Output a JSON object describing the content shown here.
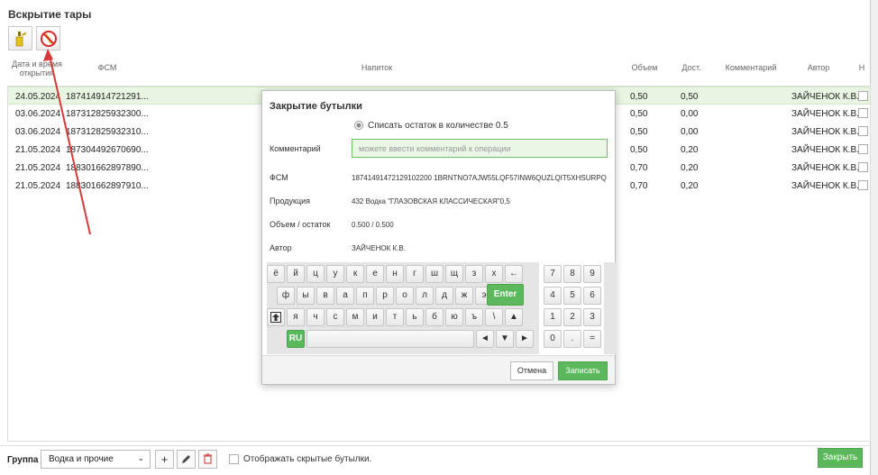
{
  "title": "Вскрытие тары",
  "toolbar": {
    "open_icon": "bottle-open-icon",
    "forbid_icon": "no-bottle-icon"
  },
  "table": {
    "headers": {
      "date": "Дата и время открытия",
      "fsm": "ФСМ",
      "drink": "Напиток",
      "volume": "Объем",
      "remain": "Дост.",
      "comment": "Комментарий",
      "author": "Автор",
      "hidden": "Н"
    },
    "rows": [
      {
        "date": "24.05.2024",
        "fsm": "187414914721291...",
        "volume": "0,50",
        "remain": "0,50",
        "author": "ЗАЙЧЕНОК К.В."
      },
      {
        "date": "03.06.2024",
        "fsm": "187312825932300...",
        "volume": "0,50",
        "remain": "0,00",
        "author": "ЗАЙЧЕНОК К.В."
      },
      {
        "date": "03.06.2024",
        "fsm": "187312825932310...",
        "volume": "0,50",
        "remain": "0,00",
        "author": "ЗАЙЧЕНОК К.В."
      },
      {
        "date": "21.05.2024",
        "fsm": "187304492670690...",
        "volume": "0,50",
        "remain": "0,20",
        "author": "ЗАЙЧЕНОК К.В."
      },
      {
        "date": "21.05.2024",
        "fsm": "188301662897890...",
        "volume": "0,70",
        "remain": "0,20",
        "author": "ЗАЙЧЕНОК К.В."
      },
      {
        "date": "21.05.2024",
        "fsm": "188301662897910...",
        "volume": "0,70",
        "remain": "0,20",
        "author": "ЗАЙЧЕНОК К.В."
      }
    ]
  },
  "bottom": {
    "group_label": "Группа",
    "group_value": "Водка и прочие",
    "show_hidden_label": "Отображать скрытые бутылки.",
    "close_label": "Закрыть"
  },
  "modal": {
    "title": "Закрытие бутылки",
    "radio_label": "Списать остаток в количестве 0.5",
    "comment_label": "Комментарий",
    "comment_placeholder": "можете ввести комментарий к операции",
    "fsm_label": "ФСМ",
    "fsm_value": "18741491472129102200 1BRNTNO7AJW55LQF57INW6QUZLQIT5XHSURPQ",
    "product_label": "Продукция",
    "product_value": "432 Водка \"ГЛАЗОВСКАЯ КЛАССИЧЕСКАЯ\"0,5",
    "volume_label": "Объем / остаток",
    "volume_value": "0.500 / 0.500",
    "author_label": "Автор",
    "author_value": "ЗАЙЧЕНОК К.В.",
    "cancel_label": "Отмена",
    "save_label": "Записать"
  },
  "keyboard": {
    "row1": [
      "ё",
      "й",
      "ц",
      "у",
      "к",
      "е",
      "н",
      "г",
      "ш",
      "щ",
      "з",
      "х",
      "←"
    ],
    "row2": [
      "ф",
      "ы",
      "в",
      "а",
      "п",
      "р",
      "о",
      "л",
      "д",
      "ж",
      "э"
    ],
    "enter": "Enter",
    "row3": [
      "я",
      "ч",
      "с",
      "м",
      "и",
      "т",
      "ь",
      "б",
      "ю",
      "ъ",
      "\\"
    ],
    "shift_icon": "shift-icon",
    "up_icon": "arrow-up-icon",
    "lang": "RU",
    "nav": [
      "◄",
      "▼",
      "►"
    ],
    "numpad": [
      [
        "7",
        "8",
        "9"
      ],
      [
        "4",
        "5",
        "6"
      ],
      [
        "1",
        "2",
        "3"
      ],
      [
        "0",
        ".",
        "="
      ]
    ]
  },
  "colors": {
    "accent": "#5cb85c",
    "selected_row": "#e7f5e2",
    "annotation_arrow": "#d9393a"
  }
}
